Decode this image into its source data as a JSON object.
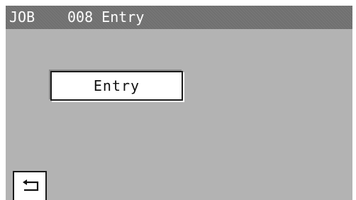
{
  "title_bar": {
    "job_label": "JOB",
    "job_name": "008 Entry"
  },
  "main": {
    "entry_button_label": "Entry"
  },
  "footer": {
    "back_icon": "return-arrow-icon"
  },
  "colors": {
    "screen_background": "#b3b3b3",
    "title_bar_background": "#707070",
    "button_background": "#ffffff",
    "text": "#111111"
  }
}
